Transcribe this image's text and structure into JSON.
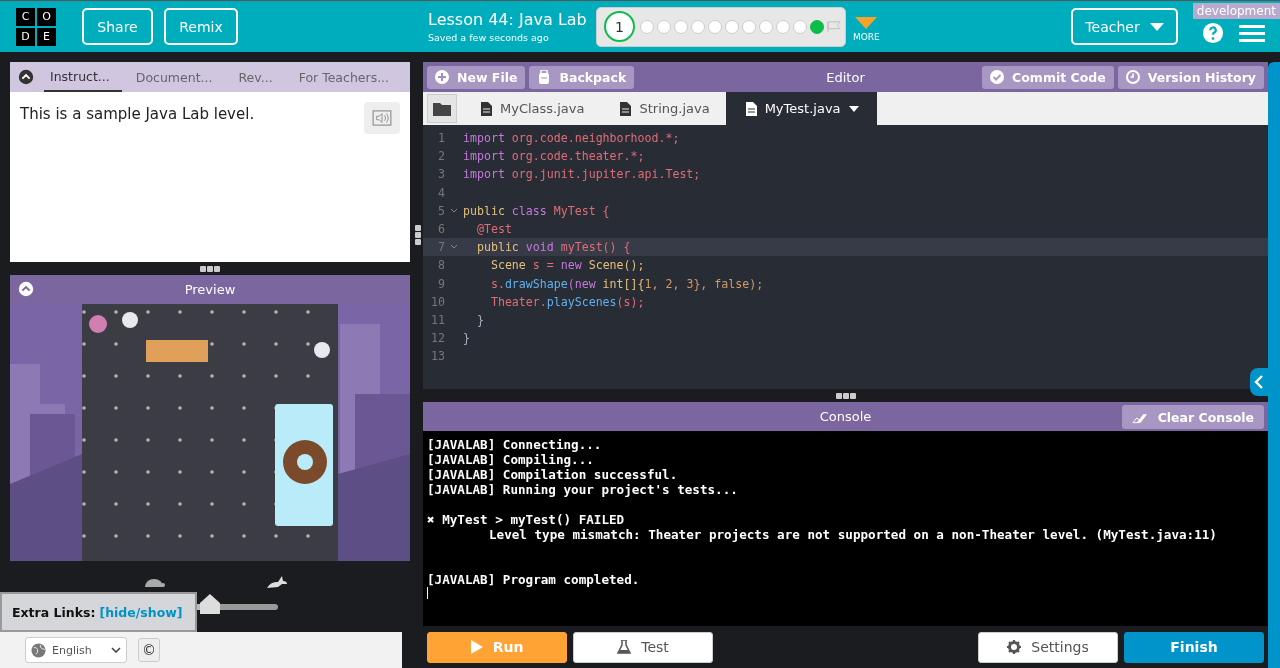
{
  "header": {
    "logo_letters": [
      "C",
      "O",
      "D",
      "E"
    ],
    "buttons": [
      "Share",
      "Remix"
    ],
    "lesson_title": "Lesson 44: Java Lab",
    "save_status": "Saved a few seconds ago",
    "progress": {
      "current_level": "1",
      "levels": [
        {
          "done": false
        },
        {
          "done": false
        },
        {
          "done": false
        },
        {
          "done": false
        },
        {
          "done": false
        },
        {
          "done": false
        },
        {
          "done": false
        },
        {
          "done": false
        },
        {
          "done": false
        },
        {
          "done": false
        },
        {
          "done": true
        }
      ]
    },
    "more_label": "MORE",
    "user_menu": "Teacher",
    "environment_badge": "development"
  },
  "instructions": {
    "tabs": [
      {
        "label": "Instruct...",
        "selected": true
      },
      {
        "label": "Document...",
        "selected": false
      },
      {
        "label": "Rev...",
        "selected": false
      },
      {
        "label": "For Teachers...",
        "selected": false
      }
    ],
    "text": "This is a sample Java Lab level."
  },
  "preview": {
    "title": "Preview",
    "speed_slider": {
      "level": 0.16
    }
  },
  "extra_links": {
    "label": "Extra Links:",
    "link": "[hide/show]"
  },
  "footer": {
    "language": "English",
    "copyright_symbol": "©"
  },
  "editor": {
    "title": "Editor",
    "left_buttons": [
      "New File",
      "Backpack"
    ],
    "right_buttons": [
      "Commit Code",
      "Version History"
    ],
    "files": [
      {
        "name": "MyClass.java",
        "selected": false
      },
      {
        "name": "String.java",
        "selected": false
      },
      {
        "name": "MyTest.java",
        "selected": true
      }
    ],
    "lines": [
      {
        "number": "1",
        "foldable": false,
        "active": false,
        "tokens": [
          {
            "text": "import",
            "color": "#c678dd"
          },
          {
            "text": " org.code.neighborhood.*;",
            "color": "#e06c75"
          }
        ]
      },
      {
        "number": "2",
        "foldable": false,
        "active": false,
        "tokens": [
          {
            "text": "import",
            "color": "#c678dd"
          },
          {
            "text": " org.code.theater.*;",
            "color": "#e06c75"
          }
        ]
      },
      {
        "number": "3",
        "foldable": false,
        "active": false,
        "tokens": [
          {
            "text": "import",
            "color": "#c678dd"
          },
          {
            "text": " org.junit.jupiter.api.Test;",
            "color": "#e06c75"
          }
        ]
      },
      {
        "number": "4",
        "foldable": false,
        "active": false
      },
      {
        "number": "5",
        "foldable": true,
        "active": false,
        "tokens": [
          {
            "text": "public",
            "color": "#e5c07b"
          },
          {
            "text": " class",
            "color": "#c678dd"
          },
          {
            "text": " MyTest {",
            "color": "#e06c75"
          }
        ]
      },
      {
        "number": "6",
        "foldable": false,
        "active": false,
        "tokens": [
          {
            "text": "  @Test",
            "color": "#e06c75"
          }
        ]
      },
      {
        "number": "7",
        "foldable": true,
        "active": true,
        "tokens": [
          {
            "text": "  public",
            "color": "#e5c07b"
          },
          {
            "text": " void",
            "color": "#c678dd"
          },
          {
            "text": " myTest() {",
            "color": "#e06c75"
          }
        ]
      },
      {
        "number": "8",
        "foldable": false,
        "active": false,
        "tokens": [
          {
            "text": "    Scene",
            "color": "#e5c07b"
          },
          {
            "text": " s = ",
            "color": "#e06c75"
          },
          {
            "text": "new",
            "color": "#c678dd"
          },
          {
            "text": " Scene();",
            "color": "#e5c07b"
          }
        ]
      },
      {
        "number": "9",
        "foldable": false,
        "active": false,
        "tokens": [
          {
            "text": "    s.",
            "color": "#e06c75"
          },
          {
            "text": "drawShape",
            "color": "#61afef"
          },
          {
            "text": "(new",
            "color": "#c678dd"
          },
          {
            "text": " int[]{",
            "color": "#e5c07b"
          },
          {
            "text": "1, 2, 3}, false);",
            "color": "#d19a66"
          }
        ]
      },
      {
        "number": "10",
        "foldable": false,
        "active": false,
        "tokens": [
          {
            "text": "    Theater.",
            "color": "#e06c75"
          },
          {
            "text": "playScenes",
            "color": "#61afef"
          },
          {
            "text": "(s);",
            "color": "#e06c75"
          }
        ]
      },
      {
        "number": "11",
        "foldable": false,
        "active": false,
        "tokens": [
          {
            "text": "  }",
            "color": "#abb2bf"
          }
        ]
      },
      {
        "number": "12",
        "foldable": false,
        "active": false,
        "tokens": [
          {
            "text": "}",
            "color": "#abb2bf"
          }
        ]
      },
      {
        "number": "13",
        "foldable": false,
        "active": false
      }
    ]
  },
  "console": {
    "title": "Console",
    "clear_button": "Clear Console",
    "lines": [
      {
        "text": "[JAVALAB] Connecting...",
        "kind": "log"
      },
      {
        "text": "[JAVALAB] Compiling...",
        "kind": "log"
      },
      {
        "text": "[JAVALAB] Compilation successful.",
        "kind": "log"
      },
      {
        "text": "[JAVALAB] Running your project's tests...",
        "kind": "log"
      },
      {
        "kind": "blank"
      },
      {
        "text": "✖ MyTest > myTest() FAILED",
        "kind": "log"
      },
      {
        "text": "Level type mismatch: Theater projects are not supported on a non-Theater level. (MyTest.java:11)",
        "kind": "detail"
      },
      {
        "kind": "blank"
      },
      {
        "kind": "blank"
      },
      {
        "text": "[JAVALAB] Program completed.",
        "kind": "log"
      }
    ]
  },
  "actions": {
    "run": "Run",
    "test": "Test",
    "settings": "Settings",
    "finish": "Finish"
  }
}
